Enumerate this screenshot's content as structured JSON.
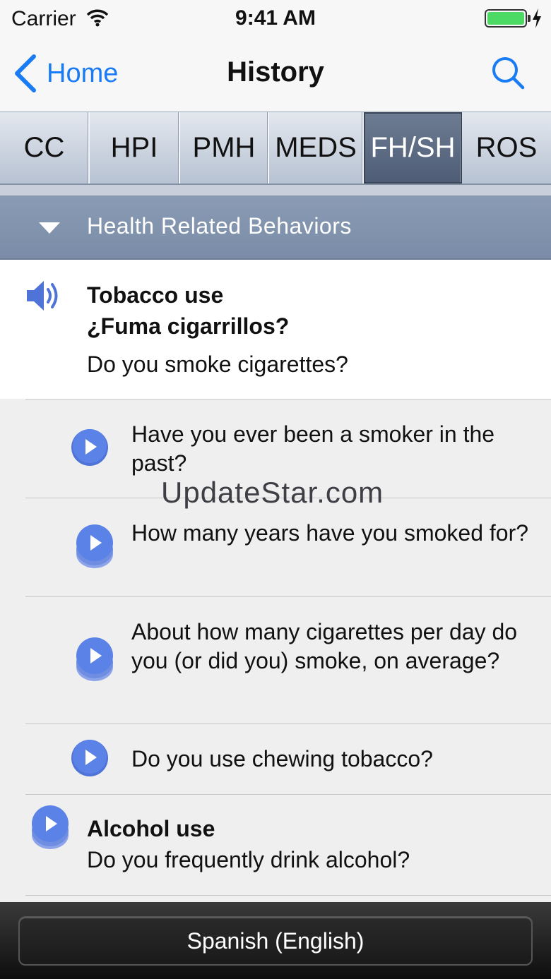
{
  "status_bar": {
    "carrier": "Carrier",
    "time": "9:41 AM"
  },
  "nav": {
    "back_label": "Home",
    "title": "History"
  },
  "tabs": [
    {
      "label": "CC"
    },
    {
      "label": "HPI"
    },
    {
      "label": "PMH"
    },
    {
      "label": "MEDS"
    },
    {
      "label": "FH/SH",
      "active": true
    },
    {
      "label": "ROS"
    }
  ],
  "section": {
    "title": "Health Related Behaviors"
  },
  "main_item": {
    "title": "Tobacco use",
    "spanish": "¿Fuma cigarrillos?",
    "english": "Do you smoke cigarettes?"
  },
  "questions": [
    {
      "text": "Have you ever been a smoker in the past?"
    },
    {
      "text": "How many years have you smoked for?"
    },
    {
      "text": "About how many cigarettes per day do you (or did you) smoke, on average?"
    },
    {
      "text": "Do you use chewing tobacco?"
    }
  ],
  "alcohol": {
    "title": "Alcohol use",
    "text": "Do you frequently drink alcohol?"
  },
  "watermark": "UpdateStar.com",
  "bottom": {
    "language_button": "Spanish (English)"
  },
  "colors": {
    "accent": "#1a7cf5",
    "section_header": "#7f91ab",
    "play_icon": "#4f73d6",
    "battery": "#4cd964"
  }
}
